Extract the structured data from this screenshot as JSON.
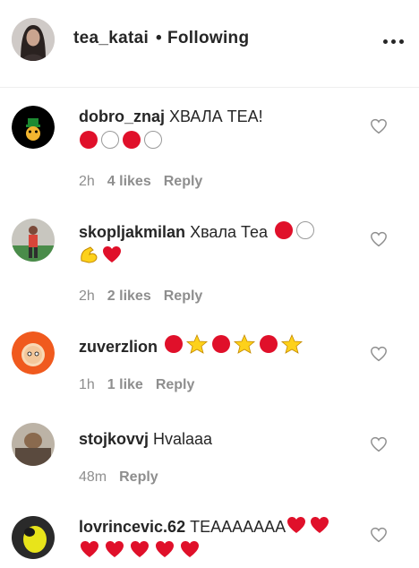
{
  "header": {
    "username": "tea_katai",
    "separator": "•",
    "follow_status": "Following"
  },
  "comments": [
    {
      "username": "dobro_znaj",
      "text": "ХВАЛА ТЕА!",
      "time": "2h",
      "likes": "4 likes",
      "reply": "Reply",
      "emojis_line2": [
        "red-circle",
        "white-circle",
        "red-circle",
        "white-circle"
      ]
    },
    {
      "username": "skopljakmilan",
      "text": "Хвала Теа",
      "time": "2h",
      "likes": "2 likes",
      "reply": "Reply",
      "emojis_line1": [
        "red-circle",
        "white-circle"
      ],
      "emojis_line2": [
        "flexed-biceps",
        "red-heart"
      ]
    },
    {
      "username": "zuverzlion",
      "text": "",
      "time": "1h",
      "likes": "1 like",
      "reply": "Reply",
      "emojis_line1": [
        "red-circle",
        "star",
        "red-circle",
        "star",
        "red-circle",
        "star"
      ]
    },
    {
      "username": "stojkovvj",
      "text": "Hvalaaa",
      "time": "48m",
      "likes": "",
      "reply": "Reply"
    },
    {
      "username": "lovrincevic.62",
      "text": "TEAAAAAAA",
      "time": "",
      "likes": "",
      "reply": "",
      "emojis_line1": [
        "red-heart",
        "red-heart"
      ],
      "emojis_line2": [
        "red-heart",
        "red-heart",
        "red-heart",
        "red-heart",
        "red-heart"
      ]
    }
  ],
  "colors": {
    "text": "#262626",
    "meta": "#8e8e8e",
    "emoji_red": "#e0102a",
    "star": "#fdd11b"
  }
}
